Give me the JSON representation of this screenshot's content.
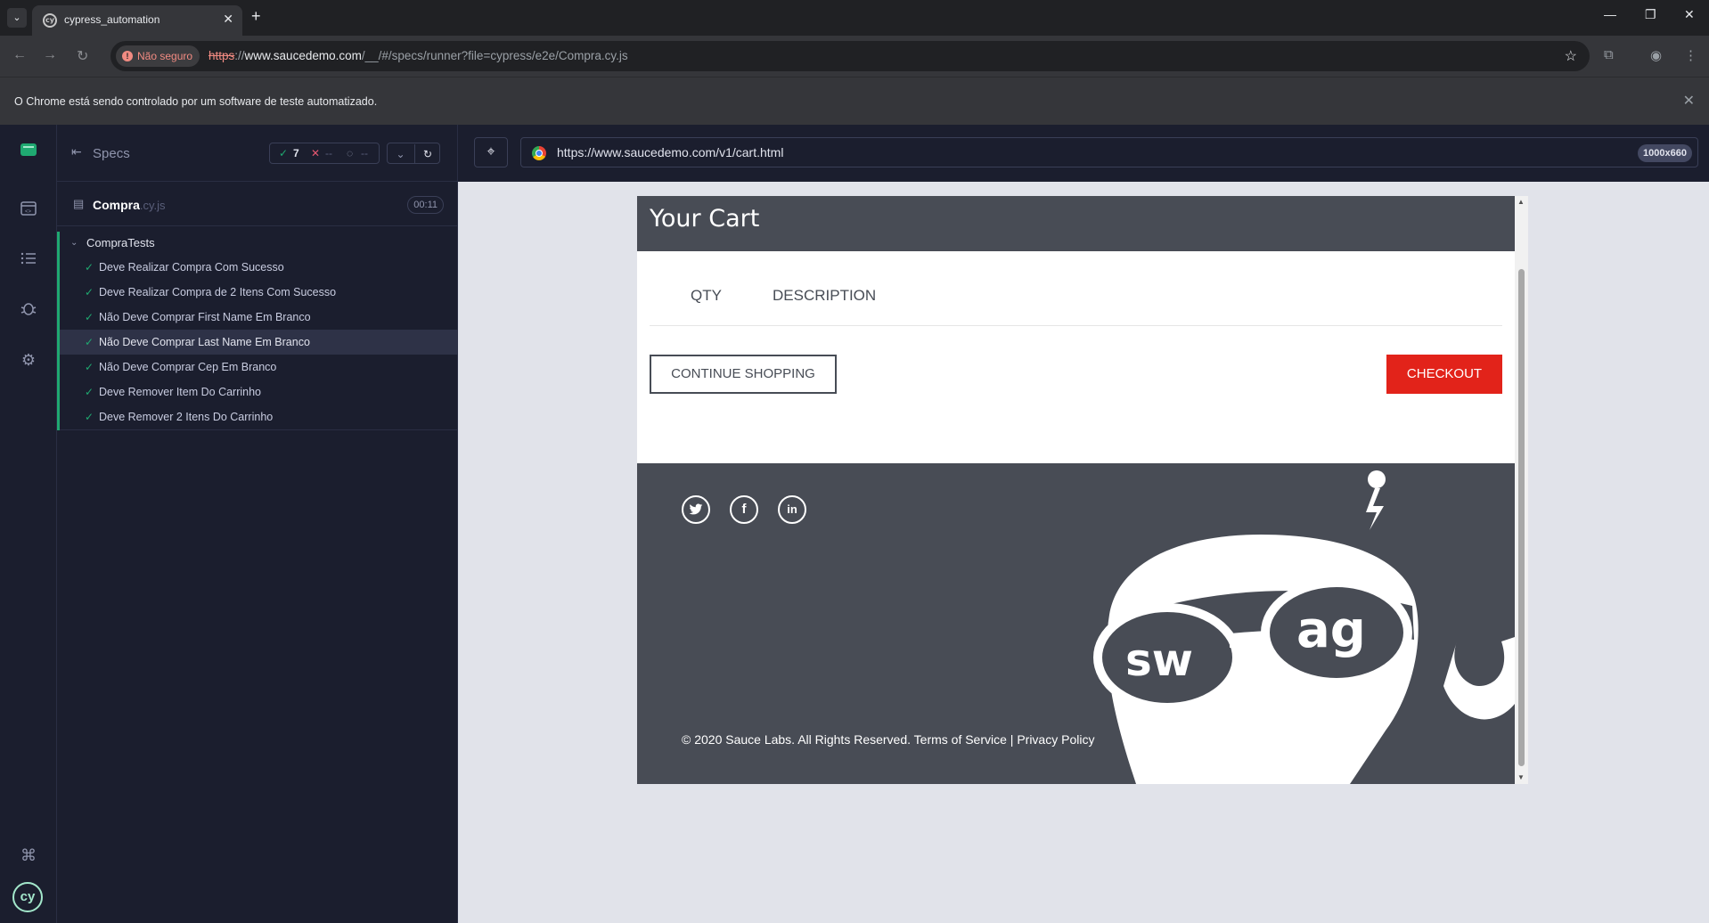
{
  "browser": {
    "tab_title": "cypress_automation",
    "url_scheme": "https",
    "url_host": "www.saucedemo.com",
    "url_path": "/__/#/specs/runner?file=cypress/e2e/Compra.cy.js",
    "security_label": "Não seguro",
    "infobar_text": "O Chrome está sendo controlado por um software de teste automatizado."
  },
  "reporter": {
    "specs_label": "Specs",
    "passed": "7",
    "failed": "--",
    "pending": "--",
    "file_name": "Compra",
    "file_ext": ".cy.js",
    "duration": "00:11",
    "suite_title": "CompraTests",
    "tests": [
      "Deve Realizar Compra Com Sucesso",
      "Deve Realizar Compra de 2 Itens Com Sucesso",
      "Não Deve Comprar First Name Em Branco",
      "Não Deve Comprar Last Name Em Branco",
      "Não Deve Comprar Cep Em Branco",
      "Deve Remover Item Do Carrinho",
      "Deve Remover 2 Itens Do Carrinho"
    ],
    "selected_test_index": 3
  },
  "aut": {
    "url": "https://www.saucedemo.com/v1/cart.html",
    "viewport": "1000x660"
  },
  "app": {
    "page_title": "Your Cart",
    "qty_label": "QTY",
    "description_label": "DESCRIPTION",
    "continue_label": "CONTINUE SHOPPING",
    "checkout_label": "CHECKOUT",
    "footer_text": "© 2020 Sauce Labs. All Rights Reserved. Terms of Service | Privacy Policy",
    "robot_text_left": "sw",
    "robot_text_right": "ag"
  },
  "colors": {
    "cypress_green": "#1fa971",
    "checkout_red": "#e2231a",
    "saucedemo_dark": "#484c55"
  }
}
